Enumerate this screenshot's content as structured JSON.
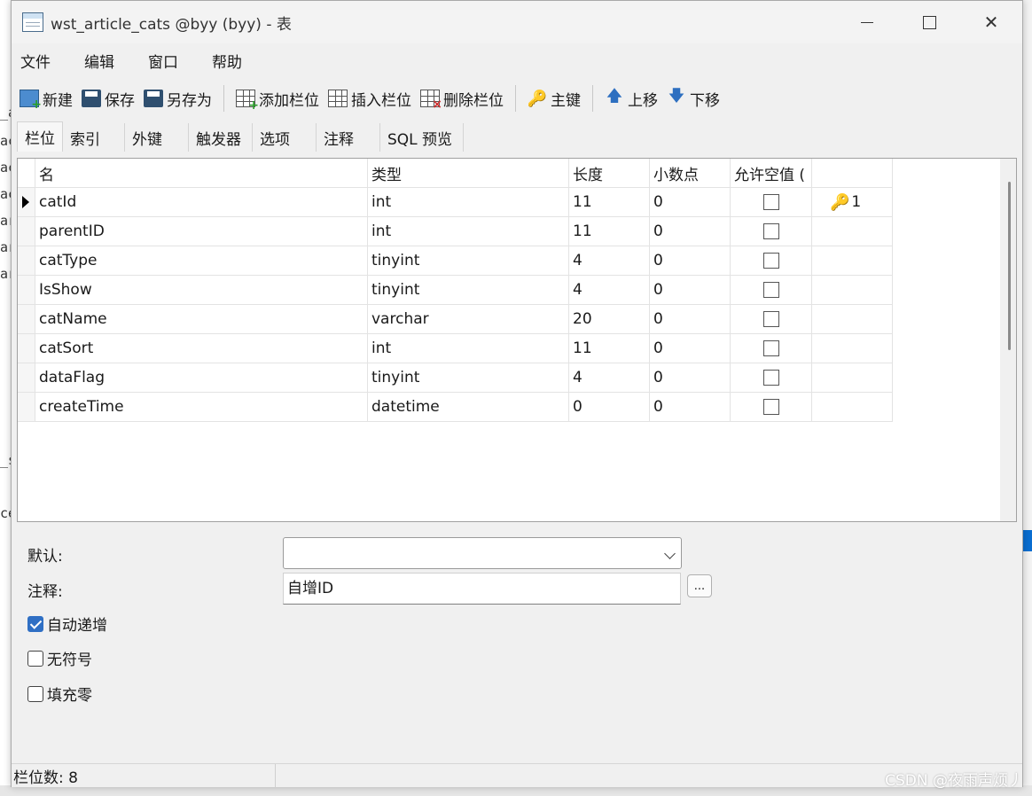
{
  "window": {
    "title": "wst_article_cats @byy (byy) - 表",
    "close_glyph": "✕"
  },
  "background": {
    "fragments": [
      "_a",
      "ac",
      "ac",
      "ac",
      "ar",
      "ar",
      "ar",
      "_s",
      "ce"
    ]
  },
  "menu": [
    "文件",
    "编辑",
    "窗口",
    "帮助"
  ],
  "toolbar": {
    "new": "新建",
    "save": "保存",
    "save_as": "另存为",
    "add_column": "添加栏位",
    "insert_column": "插入栏位",
    "delete_column": "删除栏位",
    "primary_key": "主键",
    "move_up": "上移",
    "move_down": "下移",
    "key_glyph": "🔑",
    "up_glyph": "🡅",
    "down_glyph": "🡇"
  },
  "tabs": [
    "栏位",
    "索引",
    "外键",
    "触发器",
    "选项",
    "注释",
    "SQL 预览"
  ],
  "grid": {
    "headers": {
      "name": "名",
      "type": "类型",
      "length": "长度",
      "decimals": "小数点",
      "allow_null": "允许空值 ("
    },
    "rows": [
      {
        "name": "catId",
        "type": "int",
        "length": "11",
        "decimals": "0",
        "key": "1"
      },
      {
        "name": "parentID",
        "type": "int",
        "length": "11",
        "decimals": "0",
        "key": ""
      },
      {
        "name": "catType",
        "type": "tinyint",
        "length": "4",
        "decimals": "0",
        "key": ""
      },
      {
        "name": "IsShow",
        "type": "tinyint",
        "length": "4",
        "decimals": "0",
        "key": ""
      },
      {
        "name": "catName",
        "type": "varchar",
        "length": "20",
        "decimals": "0",
        "key": ""
      },
      {
        "name": "catSort",
        "type": "int",
        "length": "11",
        "decimals": "0",
        "key": ""
      },
      {
        "name": "dataFlag",
        "type": "tinyint",
        "length": "4",
        "decimals": "0",
        "key": ""
      },
      {
        "name": "createTime",
        "type": "datetime",
        "length": "0",
        "decimals": "0",
        "key": ""
      }
    ]
  },
  "properties": {
    "default_label": "默认:",
    "default_value": "",
    "comment_label": "注释:",
    "comment_value": "自增ID",
    "ellipsis": "...",
    "auto_increment_label": "自动递增",
    "auto_increment": true,
    "unsigned_label": "无符号",
    "unsigned": false,
    "zerofill_label": "填充零",
    "zerofill": false
  },
  "status": {
    "column_count": "栏位数: 8"
  },
  "watermark": "CSDN @夜雨声烦丿"
}
